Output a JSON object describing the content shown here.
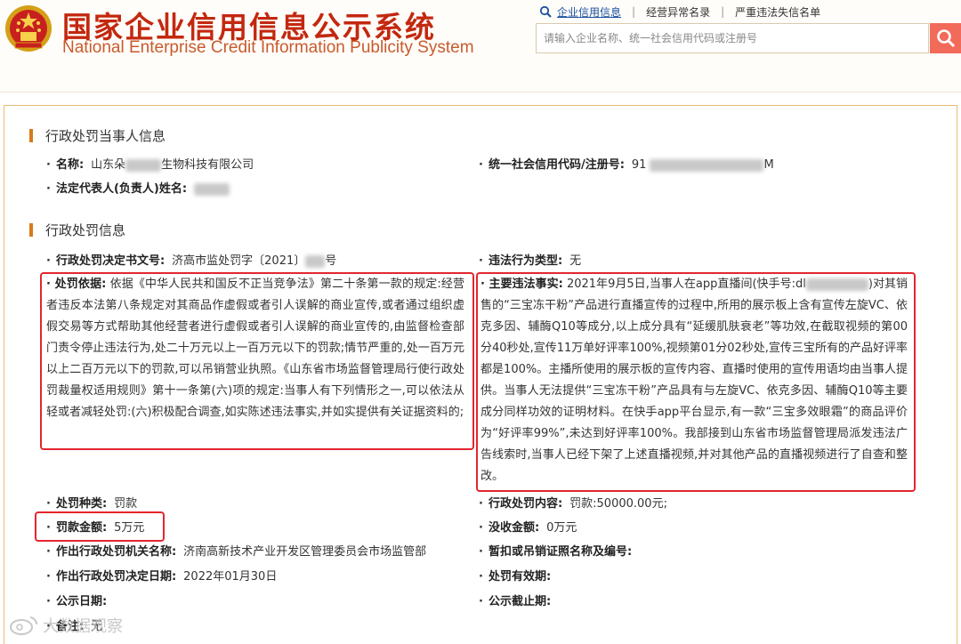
{
  "header": {
    "title_cn": "国家企业信用信息公示系统",
    "title_en": "National Enterprise Credit Information Publicity System",
    "nav": [
      "企业信用信息",
      "经营异常名录",
      "严重违法失信名单"
    ],
    "search_placeholder": "请输入企业名称、统一社会信用代码或注册号",
    "brand_color": "#c3280f"
  },
  "party": {
    "section_title": "行政处罚当事人信息",
    "name_label": "名称:",
    "name_prefix": "山东朵",
    "name_suffix": "生物科技有限公司",
    "credit_label": "统一社会信用代码/注册号:",
    "credit_prefix": "91",
    "credit_suffix": "M",
    "rep_label": "法定代表人(负责人)姓名:"
  },
  "penalty": {
    "section_title": "行政处罚信息",
    "doc_no_label": "行政处罚决定书文号:",
    "doc_no_value": "济高市监处罚字〔2021〕",
    "doc_no_suffix": "号",
    "type_label": "违法行为类型:",
    "type_value": "无",
    "basis_label": "处罚依据:",
    "basis_text": "依据《中华人民共和国反不正当竞争法》第二十条第一款的规定:经营者违反本法第八条规定对其商品作虚假或者引人误解的商业宣传,或者通过组织虚假交易等方式帮助其他经营者进行虚假或者引人误解的商业宣传的,由监督检查部门责令停止违法行为,处二十万元以上一百万元以下的罚款;情节严重的,处一百万元以上二百万元以下的罚款,可以吊销营业执照。《山东省市场监督管理局行使行政处罚裁量权适用规则》第十一条第(六)项的规定:当事人有下列情形之一,可以依法从轻或者减轻处罚:(六)积极配合调查,如实陈述违法事实,并如实提供有关证据资料的;",
    "facts_label": "主要违法事实:",
    "facts_text": "2021年9月5日,当事人在app直播间(快手号:dl",
    "facts_text2": ")对其销售的“三宝冻干粉”产品进行直播宣传的过程中,所用的展示板上含有宣传左旋VC、依克多因、辅酶Q10等成分,以上成分具有“延缓肌肤衰老”等功效,在截取视频的第00分40秒处,宣传11万单好评率100%,视频第01分02秒处,宣传三宝所有的产品好评率都是100%。主播所使用的展示板的宣传内容、直播时使用的宣传用语均由当事人提供。当事人无法提供“三宝冻干粉”产品具有与左旋VC、依克多因、辅酶Q10等主要成分同样功效的证明材料。在快手app平台显示,有一款“三宝多效眼霜”的商品评价为“好评率99%”,未达到好评率100%。我部接到山东省市场监督管理局派发违法广告线索时,当事人已经下架了上述直播视频,并对其他产品的直播视频进行了自查和整改。",
    "kind_label": "处罚种类:",
    "kind_value": "罚款",
    "content_label": "行政处罚内容:",
    "content_value": "罚款:50000.00元;",
    "amount_label": "罚款金额:",
    "amount_value": "5万元",
    "confiscation_label": "没收金额:",
    "confiscation_value": "0万元",
    "authority_label": "作出行政处罚机关名称:",
    "authority_value": "济南高新技术产业开发区管理委员会市场监管部",
    "license_label": "暂扣或吊销证照名称及编号:",
    "date_label": "作出行政处罚决定日期:",
    "date_value": "2022年01月30日",
    "validity_label": "处罚有效期:",
    "publish_label": "公示日期:",
    "publish_end_label": "公示截止期:",
    "remark_label": "备注:",
    "remark_value": "无"
  },
  "watermark": {
    "text": "大数据观察"
  }
}
